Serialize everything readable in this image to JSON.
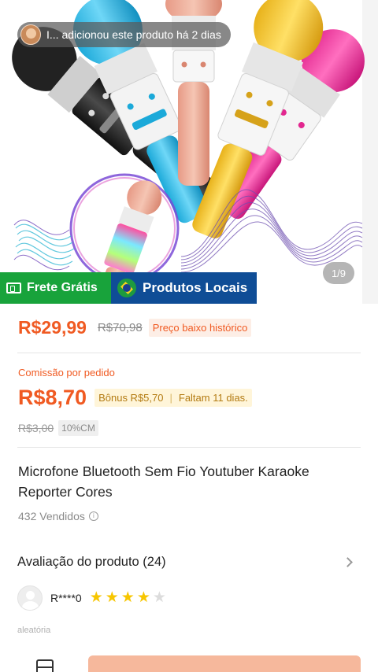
{
  "notification": {
    "text": "I... adicionou este produto há 2 dias"
  },
  "gallery": {
    "pager": "1/9"
  },
  "badges": {
    "free_shipping": "Frete Grátis",
    "local_products": "Produtos Locais"
  },
  "price": {
    "current": "R$29,99",
    "original": "R$70,98",
    "tag": "Preço baixo histórico"
  },
  "commission": {
    "label": "Comissão por pedido",
    "value": "R$8,70",
    "bonus": "Bônus R$5,70",
    "remaining": "Faltam 11 dias.",
    "old_value": "R$3,00",
    "rate": "10%CM"
  },
  "product": {
    "title": "Microfone Bluetooth Sem Fio Youtuber Karaoke Reporter Cores",
    "sold": "432 Vendidos"
  },
  "reviews": {
    "title": "Avaliação do produto (24)",
    "reviewer": "R****0",
    "rating": 4,
    "max_rating": 5,
    "sort_label": "aleatória"
  },
  "icons": {
    "notice_avatar": "user-avatar-icon",
    "free_shipping": "truck-icon",
    "local": "brazil-flag-icon",
    "info": "info-icon",
    "chevron": "chevron-right-icon",
    "star": "star-icon",
    "store": "store-icon"
  },
  "colors": {
    "accent": "#f05a22",
    "free_shipping_bg": "#18a33b",
    "local_bg": "#0f4d96",
    "star": "#f7c600",
    "cta": "#f6b89c"
  }
}
